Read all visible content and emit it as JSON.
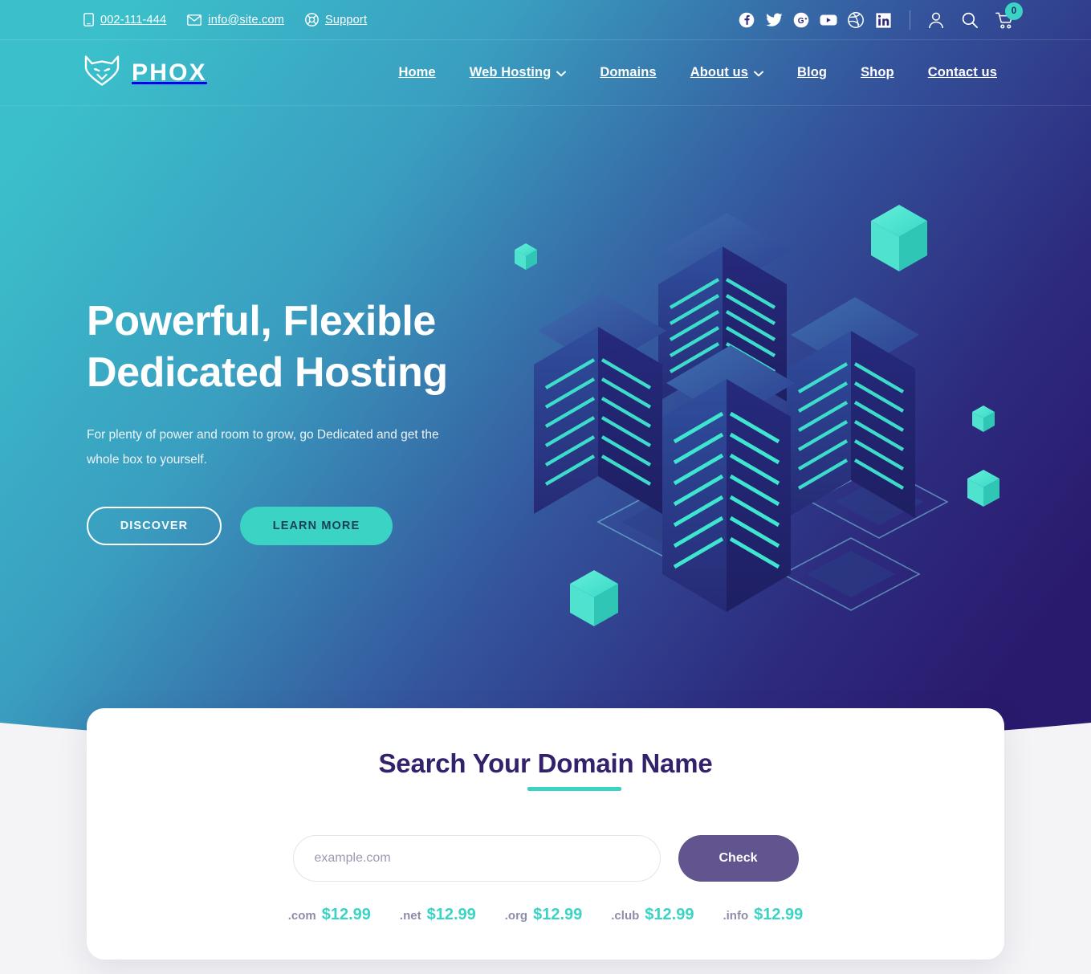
{
  "topbar": {
    "contacts": [
      {
        "icon": "phone-icon",
        "label": "002-111-444"
      },
      {
        "icon": "mail-icon",
        "label": "info@site.com"
      },
      {
        "icon": "lifebuoy-icon",
        "label": "Support"
      }
    ],
    "social": [
      {
        "name": "facebook-icon",
        "label": "Facebook"
      },
      {
        "name": "twitter-icon",
        "label": "Twitter"
      },
      {
        "name": "google-plus-icon",
        "label": "Google Plus"
      },
      {
        "name": "youtube-icon",
        "label": "YouTube"
      },
      {
        "name": "dribbble-icon",
        "label": "Dribbble"
      },
      {
        "name": "linkedin-icon",
        "label": "LinkedIn"
      }
    ],
    "actions": {
      "account_label": "Account",
      "search_label": "Search",
      "cart_label": "Cart",
      "cart_count": "0"
    }
  },
  "brand": {
    "name": "PHOX",
    "icon": "fox-logo-icon"
  },
  "nav": {
    "items": [
      {
        "label": "Home",
        "has_dropdown": false
      },
      {
        "label": "Web Hosting",
        "has_dropdown": true
      },
      {
        "label": "Domains",
        "has_dropdown": false
      },
      {
        "label": "About us",
        "has_dropdown": true
      },
      {
        "label": "Blog",
        "has_dropdown": false
      },
      {
        "label": "Shop",
        "has_dropdown": false
      },
      {
        "label": "Contact us",
        "has_dropdown": false
      }
    ]
  },
  "hero": {
    "title_line1": "Powerful, Flexible",
    "title_line2": "Dedicated Hosting",
    "subtitle": "For plenty of power and room to grow, go Dedicated and get the whole box to yourself.",
    "primary_button": "DISCOVER",
    "secondary_button": "LEARN MORE",
    "illustration": "isometric-server-towers"
  },
  "search": {
    "title": "Search Your Domain Name",
    "input_placeholder": "example.com",
    "input_value": "",
    "button_label": "Check",
    "prices": [
      {
        "tld": ".com",
        "price": "$12.99"
      },
      {
        "tld": ".net",
        "price": "$12.99"
      },
      {
        "tld": ".org",
        "price": "$12.99"
      },
      {
        "tld": ".club",
        "price": "$12.99"
      },
      {
        "tld": ".info",
        "price": "$12.99"
      }
    ]
  },
  "colors": {
    "gradient_start": "#3bbfcb",
    "gradient_end": "#2a1a6e",
    "accent_teal": "#3ad3c4",
    "heading_purple": "#33216b",
    "button_purple": "#61548f"
  }
}
